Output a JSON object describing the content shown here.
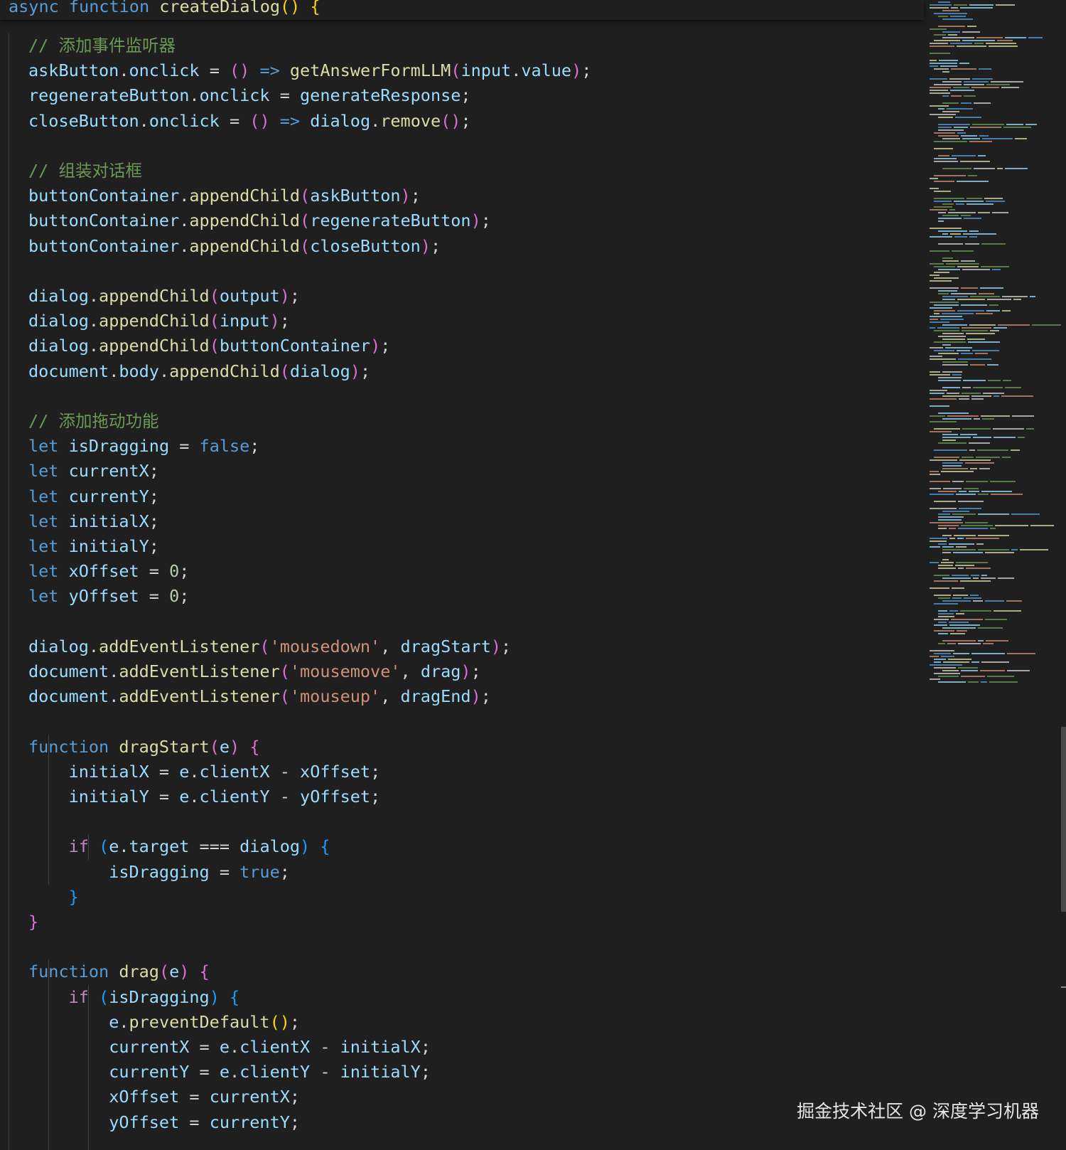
{
  "editor": {
    "sticky_header": [
      {
        "t": "async",
        "c": "kw-blue"
      },
      {
        "t": " "
      },
      {
        "t": "function",
        "c": "kw-blue"
      },
      {
        "t": " "
      },
      {
        "t": "createDialog",
        "c": "func"
      },
      {
        "t": "()",
        "c": "p1"
      },
      {
        "t": " "
      },
      {
        "t": "{",
        "c": "p1"
      }
    ],
    "lines": [
      [
        {
          "t": "// 添加事件监听器",
          "c": "cmt"
        }
      ],
      [
        {
          "t": "askButton",
          "c": "ident"
        },
        {
          "t": "."
        },
        {
          "t": "onclick",
          "c": "ident"
        },
        {
          "t": " = "
        },
        {
          "t": "()",
          "c": "p2"
        },
        {
          "t": " "
        },
        {
          "t": "=>",
          "c": "kw-blue"
        },
        {
          "t": " "
        },
        {
          "t": "getAnswerFormLLM",
          "c": "func"
        },
        {
          "t": "(",
          "c": "p2"
        },
        {
          "t": "input",
          "c": "ident"
        },
        {
          "t": "."
        },
        {
          "t": "value",
          "c": "ident"
        },
        {
          "t": ")",
          "c": "p2"
        },
        {
          "t": ";"
        }
      ],
      [
        {
          "t": "regenerateButton",
          "c": "ident"
        },
        {
          "t": "."
        },
        {
          "t": "onclick",
          "c": "ident"
        },
        {
          "t": " = "
        },
        {
          "t": "generateResponse",
          "c": "ident"
        },
        {
          "t": ";"
        }
      ],
      [
        {
          "t": "closeButton",
          "c": "ident"
        },
        {
          "t": "."
        },
        {
          "t": "onclick",
          "c": "ident"
        },
        {
          "t": " = "
        },
        {
          "t": "()",
          "c": "p2"
        },
        {
          "t": " "
        },
        {
          "t": "=>",
          "c": "kw-blue"
        },
        {
          "t": " "
        },
        {
          "t": "dialog",
          "c": "ident"
        },
        {
          "t": "."
        },
        {
          "t": "remove",
          "c": "func"
        },
        {
          "t": "()",
          "c": "p2"
        },
        {
          "t": ";"
        }
      ],
      [],
      [
        {
          "t": "// 组装对话框",
          "c": "cmt"
        }
      ],
      [
        {
          "t": "buttonContainer",
          "c": "ident"
        },
        {
          "t": "."
        },
        {
          "t": "appendChild",
          "c": "func"
        },
        {
          "t": "(",
          "c": "p2"
        },
        {
          "t": "askButton",
          "c": "ident"
        },
        {
          "t": ")",
          "c": "p2"
        },
        {
          "t": ";"
        }
      ],
      [
        {
          "t": "buttonContainer",
          "c": "ident"
        },
        {
          "t": "."
        },
        {
          "t": "appendChild",
          "c": "func"
        },
        {
          "t": "(",
          "c": "p2"
        },
        {
          "t": "regenerateButton",
          "c": "ident"
        },
        {
          "t": ")",
          "c": "p2"
        },
        {
          "t": ";"
        }
      ],
      [
        {
          "t": "buttonContainer",
          "c": "ident"
        },
        {
          "t": "."
        },
        {
          "t": "appendChild",
          "c": "func"
        },
        {
          "t": "(",
          "c": "p2"
        },
        {
          "t": "closeButton",
          "c": "ident"
        },
        {
          "t": ")",
          "c": "p2"
        },
        {
          "t": ";"
        }
      ],
      [],
      [
        {
          "t": "dialog",
          "c": "ident"
        },
        {
          "t": "."
        },
        {
          "t": "appendChild",
          "c": "func"
        },
        {
          "t": "(",
          "c": "p2"
        },
        {
          "t": "output",
          "c": "ident"
        },
        {
          "t": ")",
          "c": "p2"
        },
        {
          "t": ";"
        }
      ],
      [
        {
          "t": "dialog",
          "c": "ident"
        },
        {
          "t": "."
        },
        {
          "t": "appendChild",
          "c": "func"
        },
        {
          "t": "(",
          "c": "p2"
        },
        {
          "t": "input",
          "c": "ident"
        },
        {
          "t": ")",
          "c": "p2"
        },
        {
          "t": ";"
        }
      ],
      [
        {
          "t": "dialog",
          "c": "ident"
        },
        {
          "t": "."
        },
        {
          "t": "appendChild",
          "c": "func"
        },
        {
          "t": "(",
          "c": "p2"
        },
        {
          "t": "buttonContainer",
          "c": "ident"
        },
        {
          "t": ")",
          "c": "p2"
        },
        {
          "t": ";"
        }
      ],
      [
        {
          "t": "document",
          "c": "ident"
        },
        {
          "t": "."
        },
        {
          "t": "body",
          "c": "ident"
        },
        {
          "t": "."
        },
        {
          "t": "appendChild",
          "c": "func"
        },
        {
          "t": "(",
          "c": "p2"
        },
        {
          "t": "dialog",
          "c": "ident"
        },
        {
          "t": ")",
          "c": "p2"
        },
        {
          "t": ";"
        }
      ],
      [],
      [
        {
          "t": "// 添加拖动功能",
          "c": "cmt"
        }
      ],
      [
        {
          "t": "let",
          "c": "kw-blue"
        },
        {
          "t": " "
        },
        {
          "t": "isDragging",
          "c": "ident"
        },
        {
          "t": " = "
        },
        {
          "t": "false",
          "c": "kw-blue"
        },
        {
          "t": ";"
        }
      ],
      [
        {
          "t": "let",
          "c": "kw-blue"
        },
        {
          "t": " "
        },
        {
          "t": "currentX",
          "c": "ident"
        },
        {
          "t": ";"
        }
      ],
      [
        {
          "t": "let",
          "c": "kw-blue"
        },
        {
          "t": " "
        },
        {
          "t": "currentY",
          "c": "ident"
        },
        {
          "t": ";"
        }
      ],
      [
        {
          "t": "let",
          "c": "kw-blue"
        },
        {
          "t": " "
        },
        {
          "t": "initialX",
          "c": "ident"
        },
        {
          "t": ";"
        }
      ],
      [
        {
          "t": "let",
          "c": "kw-blue"
        },
        {
          "t": " "
        },
        {
          "t": "initialY",
          "c": "ident"
        },
        {
          "t": ";"
        }
      ],
      [
        {
          "t": "let",
          "c": "kw-blue"
        },
        {
          "t": " "
        },
        {
          "t": "xOffset",
          "c": "ident"
        },
        {
          "t": " = "
        },
        {
          "t": "0",
          "c": "num"
        },
        {
          "t": ";"
        }
      ],
      [
        {
          "t": "let",
          "c": "kw-blue"
        },
        {
          "t": " "
        },
        {
          "t": "yOffset",
          "c": "ident"
        },
        {
          "t": " = "
        },
        {
          "t": "0",
          "c": "num"
        },
        {
          "t": ";"
        }
      ],
      [],
      [
        {
          "t": "dialog",
          "c": "ident"
        },
        {
          "t": "."
        },
        {
          "t": "addEventListener",
          "c": "func"
        },
        {
          "t": "(",
          "c": "p2"
        },
        {
          "t": "'mousedown'",
          "c": "str"
        },
        {
          "t": ", "
        },
        {
          "t": "dragStart",
          "c": "ident"
        },
        {
          "t": ")",
          "c": "p2"
        },
        {
          "t": ";"
        }
      ],
      [
        {
          "t": "document",
          "c": "ident"
        },
        {
          "t": "."
        },
        {
          "t": "addEventListener",
          "c": "func"
        },
        {
          "t": "(",
          "c": "p2"
        },
        {
          "t": "'mousemove'",
          "c": "str"
        },
        {
          "t": ", "
        },
        {
          "t": "drag",
          "c": "ident"
        },
        {
          "t": ")",
          "c": "p2"
        },
        {
          "t": ";"
        }
      ],
      [
        {
          "t": "document",
          "c": "ident"
        },
        {
          "t": "."
        },
        {
          "t": "addEventListener",
          "c": "func"
        },
        {
          "t": "(",
          "c": "p2"
        },
        {
          "t": "'mouseup'",
          "c": "str"
        },
        {
          "t": ", "
        },
        {
          "t": "dragEnd",
          "c": "ident"
        },
        {
          "t": ")",
          "c": "p2"
        },
        {
          "t": ";"
        }
      ],
      [],
      [
        {
          "t": "function",
          "c": "kw-blue"
        },
        {
          "t": " "
        },
        {
          "t": "dragStart",
          "c": "func"
        },
        {
          "t": "(",
          "c": "p2"
        },
        {
          "t": "e",
          "c": "ident"
        },
        {
          "t": ")",
          "c": "p2"
        },
        {
          "t": " "
        },
        {
          "t": "{",
          "c": "p2"
        }
      ],
      [
        {
          "t": "    "
        },
        {
          "t": "initialX",
          "c": "ident"
        },
        {
          "t": " = "
        },
        {
          "t": "e",
          "c": "ident"
        },
        {
          "t": "."
        },
        {
          "t": "clientX",
          "c": "ident"
        },
        {
          "t": " - "
        },
        {
          "t": "xOffset",
          "c": "ident"
        },
        {
          "t": ";"
        }
      ],
      [
        {
          "t": "    "
        },
        {
          "t": "initialY",
          "c": "ident"
        },
        {
          "t": " = "
        },
        {
          "t": "e",
          "c": "ident"
        },
        {
          "t": "."
        },
        {
          "t": "clientY",
          "c": "ident"
        },
        {
          "t": " - "
        },
        {
          "t": "yOffset",
          "c": "ident"
        },
        {
          "t": ";"
        }
      ],
      [],
      [
        {
          "t": "    "
        },
        {
          "t": "if",
          "c": "kw-purple"
        },
        {
          "t": " "
        },
        {
          "t": "(",
          "c": "p3"
        },
        {
          "t": "e",
          "c": "ident"
        },
        {
          "t": "."
        },
        {
          "t": "target",
          "c": "ident"
        },
        {
          "t": " === "
        },
        {
          "t": "dialog",
          "c": "ident"
        },
        {
          "t": ")",
          "c": "p3"
        },
        {
          "t": " "
        },
        {
          "t": "{",
          "c": "p3"
        }
      ],
      [
        {
          "t": "        "
        },
        {
          "t": "isDragging",
          "c": "ident"
        },
        {
          "t": " = "
        },
        {
          "t": "true",
          "c": "kw-blue"
        },
        {
          "t": ";"
        }
      ],
      [
        {
          "t": "    "
        },
        {
          "t": "}",
          "c": "p3"
        }
      ],
      [
        {
          "t": "}",
          "c": "p2"
        }
      ],
      [],
      [
        {
          "t": "function",
          "c": "kw-blue"
        },
        {
          "t": " "
        },
        {
          "t": "drag",
          "c": "func"
        },
        {
          "t": "(",
          "c": "p2"
        },
        {
          "t": "e",
          "c": "ident"
        },
        {
          "t": ")",
          "c": "p2"
        },
        {
          "t": " "
        },
        {
          "t": "{",
          "c": "p2"
        }
      ],
      [
        {
          "t": "    "
        },
        {
          "t": "if",
          "c": "kw-purple"
        },
        {
          "t": " "
        },
        {
          "t": "(",
          "c": "p3"
        },
        {
          "t": "isDragging",
          "c": "ident"
        },
        {
          "t": ")",
          "c": "p3"
        },
        {
          "t": " "
        },
        {
          "t": "{",
          "c": "p3"
        }
      ],
      [
        {
          "t": "        "
        },
        {
          "t": "e",
          "c": "ident"
        },
        {
          "t": "."
        },
        {
          "t": "preventDefault",
          "c": "func"
        },
        {
          "t": "()",
          "c": "p1"
        },
        {
          "t": ";"
        }
      ],
      [
        {
          "t": "        "
        },
        {
          "t": "currentX",
          "c": "ident"
        },
        {
          "t": " = "
        },
        {
          "t": "e",
          "c": "ident"
        },
        {
          "t": "."
        },
        {
          "t": "clientX",
          "c": "ident"
        },
        {
          "t": " - "
        },
        {
          "t": "initialX",
          "c": "ident"
        },
        {
          "t": ";"
        }
      ],
      [
        {
          "t": "        "
        },
        {
          "t": "currentY",
          "c": "ident"
        },
        {
          "t": " = "
        },
        {
          "t": "e",
          "c": "ident"
        },
        {
          "t": "."
        },
        {
          "t": "clientY",
          "c": "ident"
        },
        {
          "t": " - "
        },
        {
          "t": "initialY",
          "c": "ident"
        },
        {
          "t": ";"
        }
      ],
      [
        {
          "t": "        "
        },
        {
          "t": "xOffset",
          "c": "ident"
        },
        {
          "t": " = "
        },
        {
          "t": "currentX",
          "c": "ident"
        },
        {
          "t": ";"
        }
      ],
      [
        {
          "t": "        "
        },
        {
          "t": "yOffset",
          "c": "ident"
        },
        {
          "t": " = "
        },
        {
          "t": "currentY",
          "c": "ident"
        },
        {
          "t": ";"
        }
      ]
    ]
  },
  "colors": {
    "background": "#1f1f1f",
    "keyword": "#569cd6",
    "control_keyword": "#c586c0",
    "identifier": "#9cdcfe",
    "function": "#dcdcaa",
    "string": "#ce9178",
    "number": "#b5cea8",
    "comment": "#6a9955",
    "bracket_gold": "#ffd700",
    "bracket_orchid": "#da70d6",
    "bracket_blue": "#179fff"
  },
  "watermark": "掘金技术社区 @ 深度学习机器"
}
